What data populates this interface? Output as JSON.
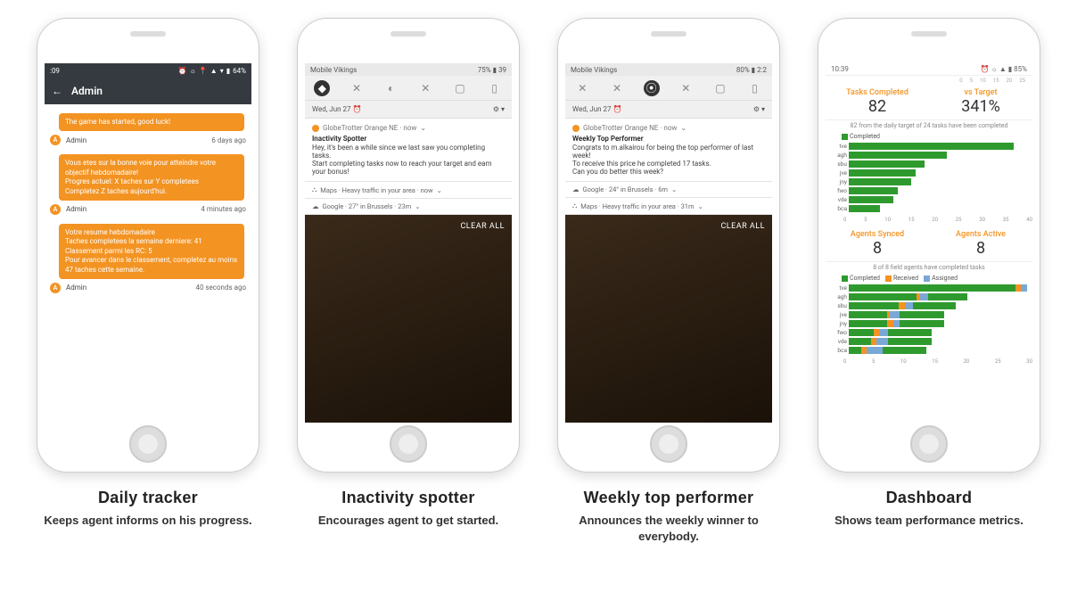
{
  "captions": [
    {
      "title": "Daily tracker",
      "sub": "Keeps agent informs on his progress."
    },
    {
      "title": "Inactivity spotter",
      "sub": "Encourages agent to get started."
    },
    {
      "title": "Weekly top performer",
      "sub": "Announces the weekly winner to everybody."
    },
    {
      "title": "Dashboard",
      "sub": "Shows team performance metrics."
    }
  ],
  "p1": {
    "status_time": ":09",
    "status_battery": "64%",
    "title": "Admin",
    "msgs": [
      {
        "text": "The game has started, good luck!",
        "sender": "Admin",
        "when": "6 days ago"
      },
      {
        "text": "Vous etes sur la bonne voie pour atteindre votre objectif hebdomadaire!\nProgres actuel: X taches sur Y completees\nCompletez Z taches aujourd'hui.",
        "sender": "Admin",
        "when": "4 minutes ago"
      },
      {
        "text": "Votre resume hebdomadaire\nTaches completees la semaine derniere: 41\nClassement parmi les RC: 5\nPour avancer dans le classement, completez au moins 47 taches cette semaine.",
        "sender": "Admin",
        "when": "40 seconds ago"
      }
    ]
  },
  "p2": {
    "carrier": "Mobile Vikings",
    "battery": "75%",
    "clock": "39",
    "date": "Wed, Jun 27",
    "app_line": "GlobeTrotter Orange NE · now",
    "ntitle": "Inactivity Spotter",
    "nbody": "Hey, it's been a while since we last saw you completing tasks.\nStart completing tasks now to reach your target and earn your bonus!",
    "rows": [
      "Maps · Heavy traffic in your area · now",
      "Google · 27° in Brussels · 23m"
    ],
    "clear": "CLEAR ALL"
  },
  "p3": {
    "carrier": "Mobile Vikings",
    "battery": "80%",
    "clock": "2:2",
    "date": "Wed, Jun 27",
    "app_line": "GlobeTrotter Orange NE · now",
    "ntitle": "Weekly Top Performer",
    "nbody": "Congrats to m.alkairou for being the top performer of last week!\nTo receive this price he completed 17 tasks.\nCan you do better this week?",
    "rows": [
      "Google · 24° in Brussels · 6m",
      "Maps · Heavy traffic in your area · 31m"
    ],
    "clear": "CLEAR ALL"
  },
  "p4": {
    "status_time": "10:39",
    "status_battery": "85%",
    "top_ticks": [
      "0",
      "5",
      "10",
      "15",
      "20",
      "25"
    ],
    "kpi1": {
      "label": "Tasks Completed",
      "value": "82"
    },
    "kpi2": {
      "label": "vs Target",
      "value": "341%"
    },
    "note1": "82 from the daily target of 24 tasks have been completed",
    "legend1": "Completed",
    "legend2": [
      "Completed",
      "Received",
      "Assigned"
    ],
    "kpi3": {
      "label": "Agents Synced",
      "value": "8"
    },
    "kpi4": {
      "label": "Agents Active",
      "value": "8"
    },
    "note2": "8 of 8 field agents have completed tasks",
    "xaxis1": [
      "0",
      "5",
      "10",
      "15",
      "20",
      "25",
      "30",
      "35",
      "40"
    ],
    "xaxis2": [
      "0",
      "5",
      "10",
      "15",
      "20",
      "25",
      "30"
    ]
  },
  "chart_data": [
    {
      "type": "bar",
      "title": "Tasks Completed per agent",
      "xlabel": "",
      "ylabel": "",
      "xlim": [
        0,
        40
      ],
      "categories": [
        "tve",
        "agh",
        "sbu",
        "jve",
        "jny",
        "fwo",
        "vde",
        "bca"
      ],
      "series": [
        {
          "name": "Completed",
          "values": [
            37,
            22,
            17,
            15,
            14,
            11,
            10,
            7
          ]
        }
      ]
    },
    {
      "type": "bar",
      "title": "Agent task status",
      "xlabel": "",
      "ylabel": "",
      "xlim": [
        0,
        30
      ],
      "categories": [
        "tve",
        "agh",
        "sbu",
        "jve",
        "jny",
        "fwo",
        "vde",
        "bca"
      ],
      "series": [
        {
          "name": "Completed",
          "values": [
            28,
            17,
            14,
            12,
            12,
            9,
            8,
            5
          ]
        },
        {
          "name": "Received",
          "values": [
            1,
            1,
            2,
            1,
            2,
            2,
            2,
            2
          ]
        },
        {
          "name": "Assigned",
          "values": [
            1,
            2,
            2,
            3,
            2,
            3,
            4,
            6
          ]
        }
      ]
    }
  ]
}
